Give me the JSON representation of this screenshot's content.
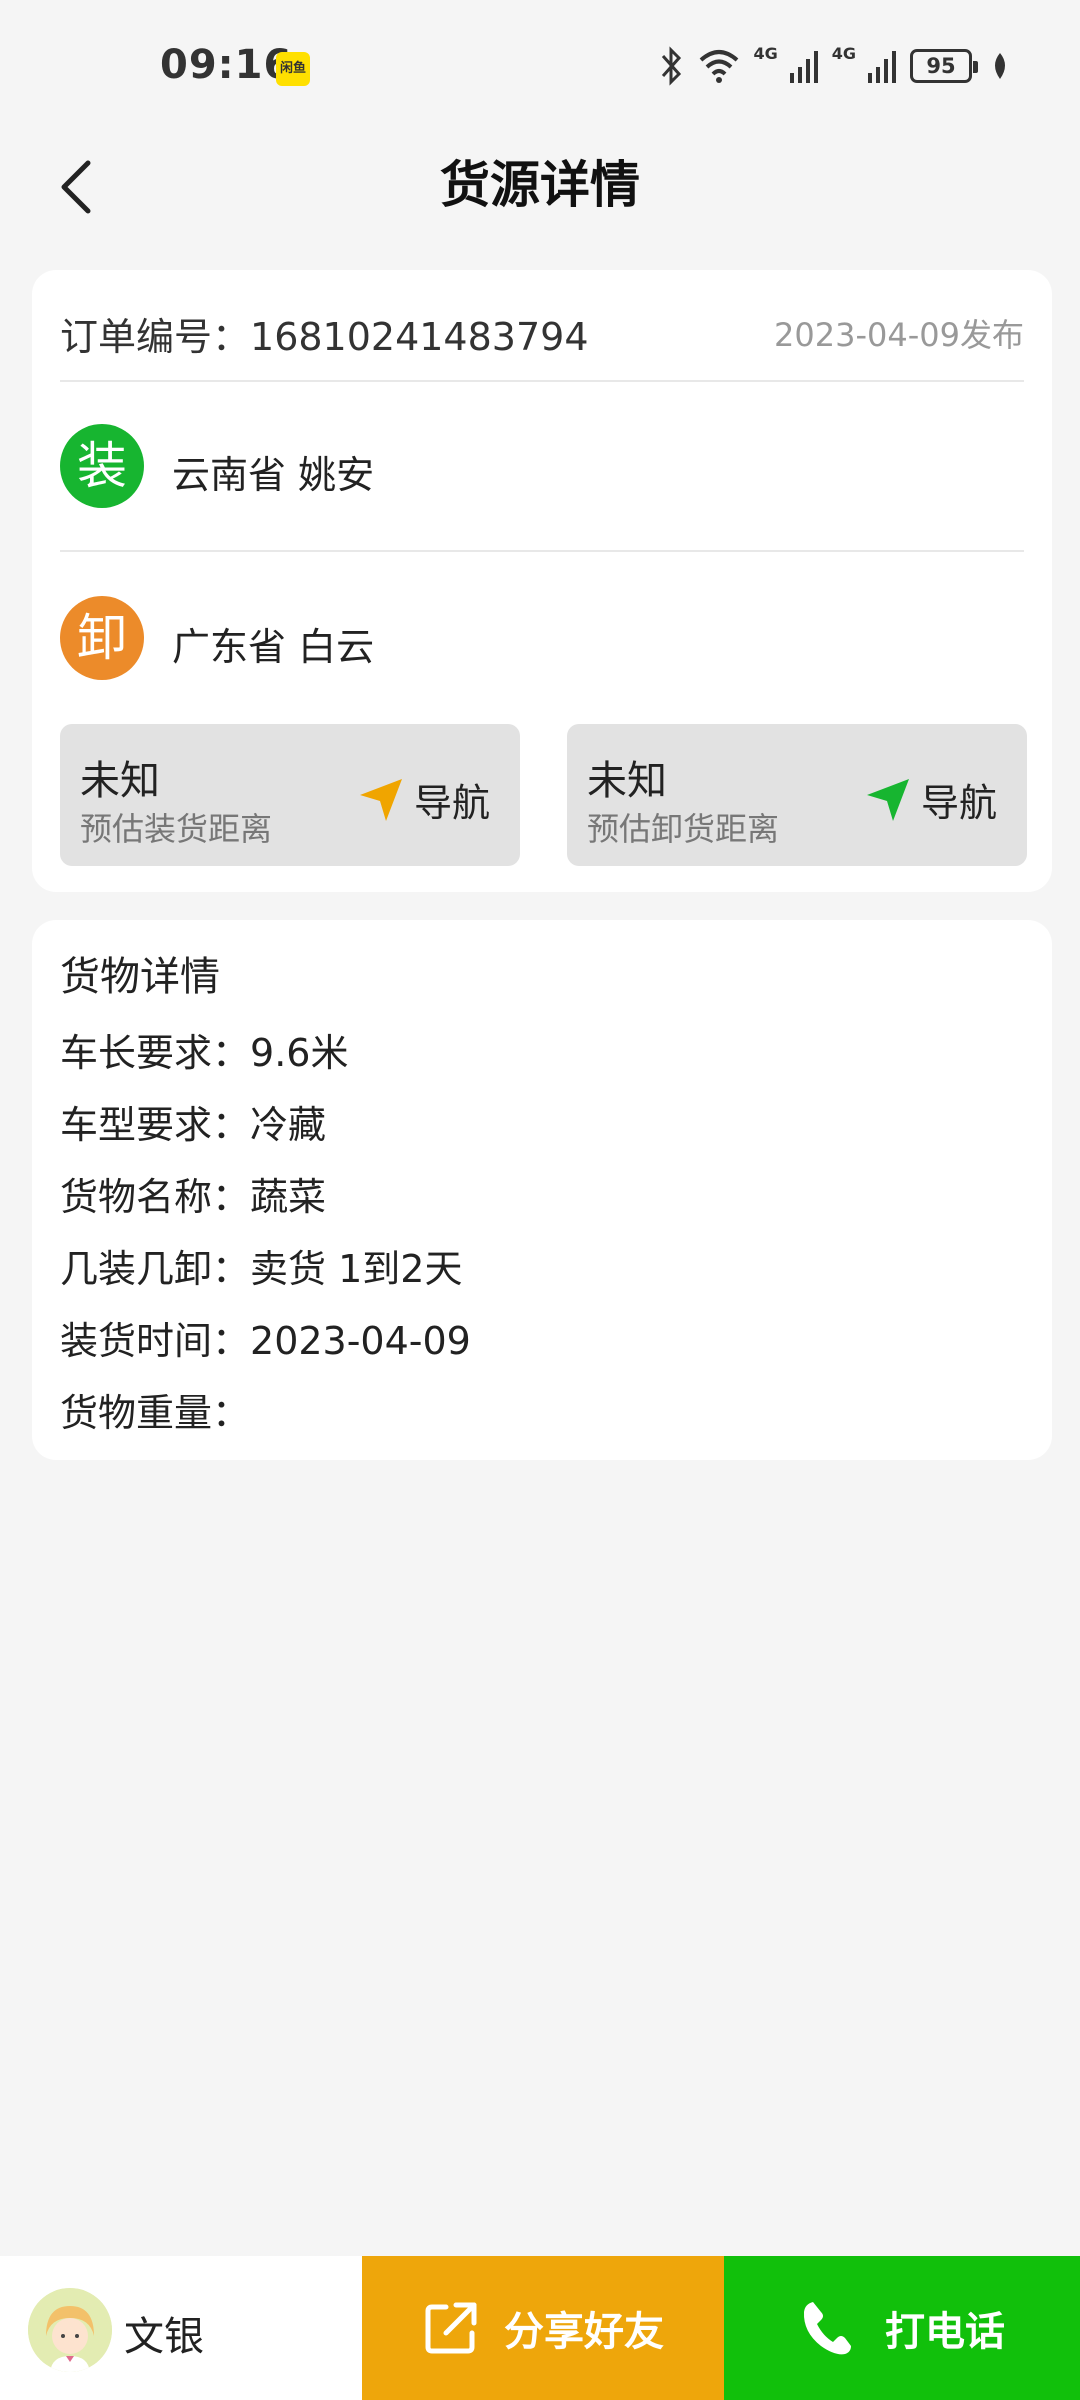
{
  "status_bar": {
    "time": "09:16",
    "app_badge": "闲鱼",
    "network_1": "4G",
    "network_2": "4G",
    "battery": "95"
  },
  "nav": {
    "title": "货源详情"
  },
  "order": {
    "label": "订单编号：",
    "number": "16810241483794",
    "date": "2023-04-09发布"
  },
  "route": {
    "load": {
      "badge": "装",
      "location": "云南省 姚安"
    },
    "unload": {
      "badge": "卸",
      "location": "广东省 白云"
    },
    "load_distance": {
      "value": "未知",
      "label": "预估装货距离",
      "nav_label": "导航"
    },
    "unload_distance": {
      "value": "未知",
      "label": "预估卸货距离",
      "nav_label": "导航"
    }
  },
  "goods": {
    "title": "货物详情",
    "rows": [
      {
        "label": "车长要求：",
        "value": "9.6米"
      },
      {
        "label": "车型要求：",
        "value": "冷藏"
      },
      {
        "label": "货物名称：",
        "value": "蔬菜"
      },
      {
        "label": "几装几卸：",
        "value": "卖货 1到2天"
      },
      {
        "label": "装货时间：",
        "value": "2023-04-09"
      },
      {
        "label": "货物重量：",
        "value": ""
      }
    ]
  },
  "bottom": {
    "contact_name": "文银",
    "share_label": "分享好友",
    "call_label": "打电话"
  },
  "colors": {
    "load_green": "#17b530",
    "unload_orange": "#ec8b2a",
    "share_yellow": "#eea60b",
    "call_green": "#11c00b",
    "nav_arrow_orange": "#f0a500",
    "nav_arrow_green": "#17b530"
  }
}
